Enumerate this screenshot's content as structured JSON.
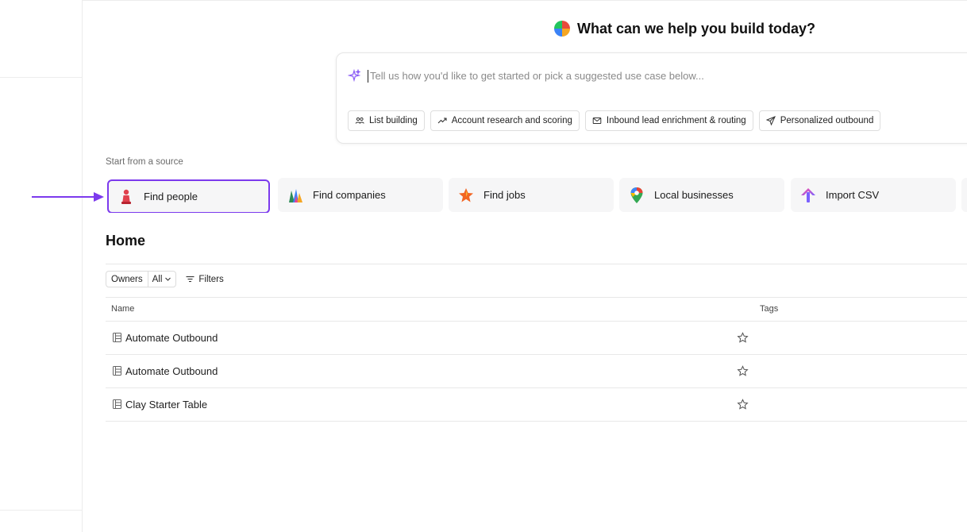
{
  "hero": {
    "title": "What can we help you build today?"
  },
  "prompt": {
    "placeholder": "Tell us how you'd like to get started or pick a suggested use case below...",
    "chips": [
      {
        "label": "List building",
        "icon": "people-icon"
      },
      {
        "label": "Account research and scoring",
        "icon": "trend-up-icon"
      },
      {
        "label": "Inbound lead enrichment & routing",
        "icon": "mail-icon"
      },
      {
        "label": "Personalized outbound",
        "icon": "send-icon"
      }
    ]
  },
  "sources": {
    "label": "Start from a source",
    "items": [
      {
        "label": "Find people",
        "icon": "person-icon"
      },
      {
        "label": "Find companies",
        "icon": "buildings-icon"
      },
      {
        "label": "Find jobs",
        "icon": "star-icon"
      },
      {
        "label": "Local businesses",
        "icon": "map-pin-icon"
      },
      {
        "label": "Import CSV",
        "icon": "upload-arrow-icon"
      }
    ]
  },
  "home": {
    "title": "Home",
    "owners_label": "Owners",
    "owners_value": "All",
    "filters_label": "Filters",
    "columns": {
      "name": "Name",
      "tags": "Tags"
    },
    "rows": [
      {
        "name": "Automate Outbound"
      },
      {
        "name": "Automate Outbound"
      },
      {
        "name": "Clay Starter Table"
      }
    ]
  },
  "colors": {
    "highlight": "#7c3aed",
    "accent_spark": "#8b5cf6"
  }
}
